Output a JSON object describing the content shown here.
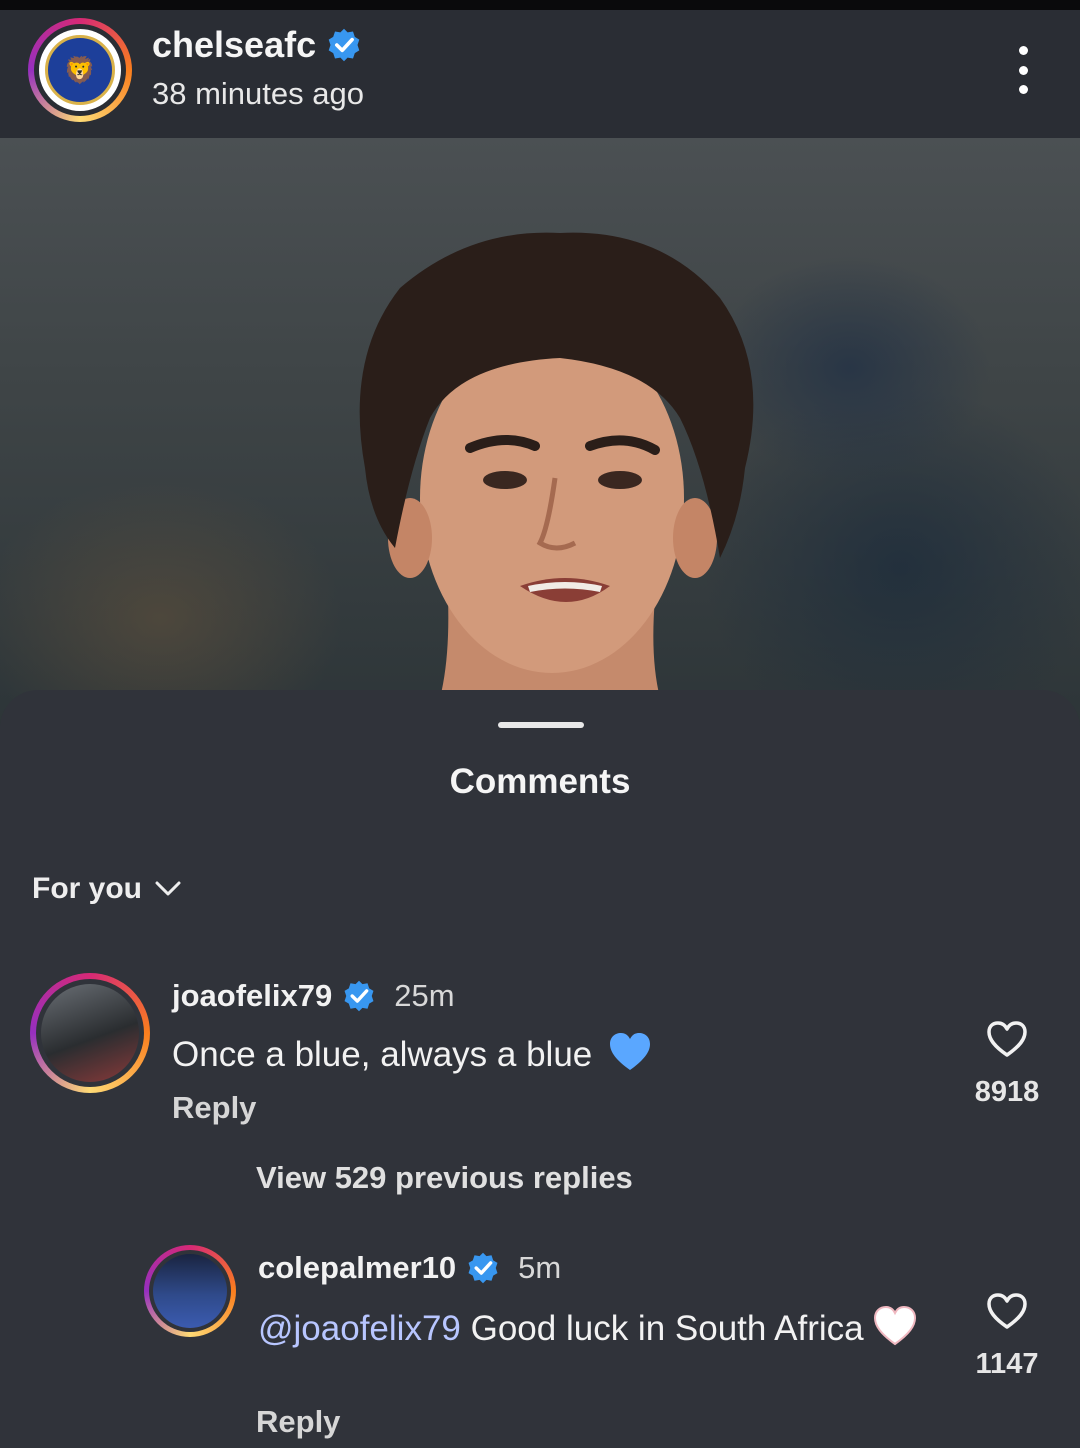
{
  "post": {
    "username": "chelseafc",
    "time_ago": "38 minutes ago"
  },
  "comments_sheet": {
    "title": "Comments",
    "filter_label": "For you",
    "comments": [
      {
        "username": "joaofelix79",
        "time": "25m",
        "text": "Once a blue, always a blue",
        "reply_label": "Reply",
        "like_count": "8918"
      }
    ],
    "view_replies_label": "View 529 previous replies",
    "reply": {
      "username": "colepalmer10",
      "time": "5m",
      "mention": "@joaofelix79",
      "text": "Good luck in South Africa",
      "reply_label": "Reply",
      "like_count": "1147"
    }
  },
  "colors": {
    "verified": "#3897f0",
    "blue_heart": "#5aa7ff",
    "white_heart": "#ffffff",
    "mention": "#b8c6ff"
  },
  "icons": [
    "verified-badge-icon",
    "more-options-icon",
    "chevron-down-icon",
    "heart-outline-icon",
    "blue-heart-emoji",
    "white-heart-emoji"
  ]
}
